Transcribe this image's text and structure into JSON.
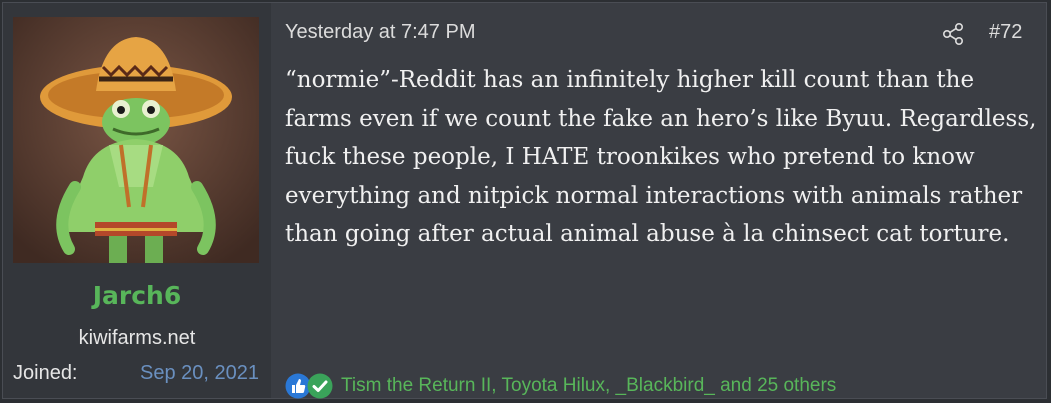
{
  "user": {
    "username": "Jarch6",
    "title": "kiwifarms.net",
    "joined_label": "Joined:",
    "joined_date": "Sep 20, 2021"
  },
  "post": {
    "date": "Yesterday at 7:47 PM",
    "number": "#72",
    "body": "“normie”-Reddit has an infinitely higher kill count than the farms even if we count the fake an hero’s like Byuu. Regardless, fuck these people, I HATE troonkikes who pretend to know everything and nitpick normal interactions with animals rather than going after actual animal abuse à la chinsect cat torture."
  },
  "reactions": {
    "icons": [
      "like-icon",
      "agree-check-icon"
    ],
    "text": "Tism the Return II, Toyota Hilux, _Blackbird_ and 25 others"
  },
  "colors": {
    "username": "#58b65a",
    "joined_date": "#6a90c0",
    "background": "#3a3d43"
  }
}
